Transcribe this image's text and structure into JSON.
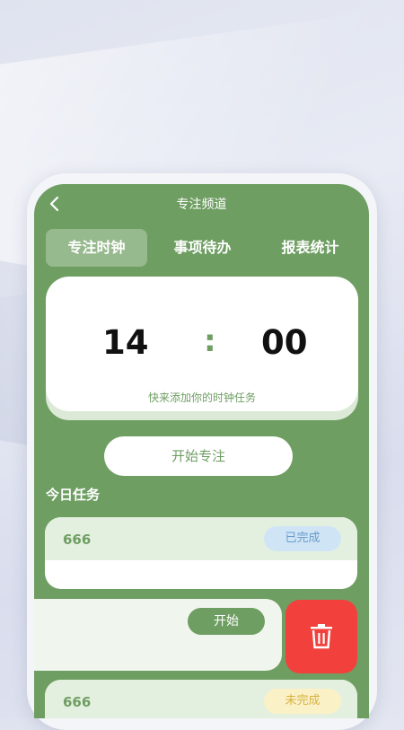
{
  "header": {
    "title": "专注频道"
  },
  "tabs": [
    {
      "label": "专注时钟",
      "active": true
    },
    {
      "label": "事项待办",
      "active": false
    },
    {
      "label": "报表统计",
      "active": false
    }
  ],
  "clock": {
    "minutes": "14",
    "separator": ":",
    "seconds": "00",
    "hint": "快来添加你的时钟任务"
  },
  "start_focus_label": "开始专注",
  "today_tasks": {
    "title": "今日任务",
    "items": [
      {
        "name": "666",
        "status": "已完成"
      },
      {
        "name": "",
        "action": "开始"
      },
      {
        "name": "666",
        "status": "未完成"
      }
    ]
  },
  "icons": {
    "back": "chevron-left-icon",
    "delete": "trash-icon"
  },
  "colors": {
    "primary": "#6f9e63",
    "delete": "#f2413c",
    "done_badge": "#cfe5f6",
    "undone_badge": "#fbf1c7"
  }
}
